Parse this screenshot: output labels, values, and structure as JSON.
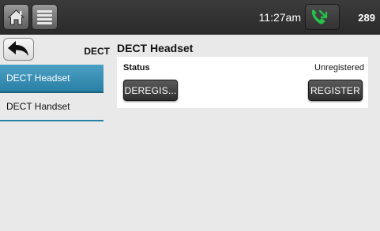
{
  "topbar": {
    "time": "11:27am",
    "extension": "289",
    "icons": {
      "home": "home-icon",
      "menu": "menu-list-icon",
      "phone": "phone-call-icon"
    }
  },
  "sidebar": {
    "back_icon": "back-arrow-icon",
    "section_label": "DECT",
    "items": [
      {
        "label": "DECT Headset",
        "active": true
      },
      {
        "label": "DECT Handset",
        "active": false
      }
    ]
  },
  "main": {
    "title": "DECT Headset",
    "status_label": "Status",
    "status_value": "Unregistered",
    "deregister_label": "DEREGIS...",
    "register_label": "REGISTER"
  },
  "colors": {
    "accent": "#2a7fa6",
    "topbar": "#2f2f2f",
    "phone_icon": "#25c24a"
  }
}
